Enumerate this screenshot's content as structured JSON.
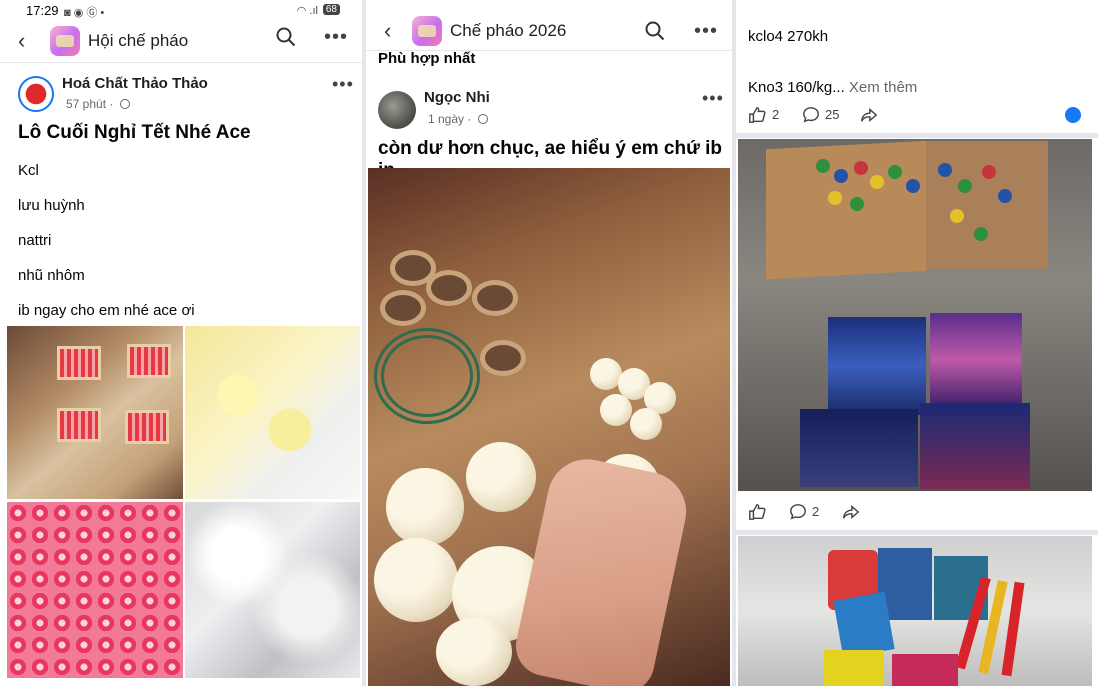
{
  "status_bar": {
    "time": "17:29",
    "battery": "68"
  },
  "panel1": {
    "group_name": "Hội chế pháo",
    "post": {
      "author": "Hoá Chất Thảo Thảo",
      "time": "57 phút",
      "headline": "Lô Cuối Nghỉ Tết Nhé Ace",
      "lines": [
        "Kcl",
        "lưu huỳnh",
        "nattri",
        "nhũ nhôm",
        "ib ngay cho em nhé ace ơi"
      ]
    }
  },
  "panel2": {
    "group_name": "Chế pháo 2026",
    "section_label": "Phù hợp nhất",
    "post": {
      "author": "Ngọc Nhi",
      "time": "1 ngày",
      "text": "còn dư hơn chục, ae hiểu ý em chứ ib in"
    }
  },
  "panel3": {
    "lines": [
      "kclo4 270kh",
      "Kno3 160/kg..."
    ],
    "see_more": "Xem thêm",
    "post1": {
      "likes": "2",
      "comments": "25"
    },
    "post2": {
      "comments": "2"
    },
    "colors": {
      "accent": "#1877f2"
    }
  }
}
